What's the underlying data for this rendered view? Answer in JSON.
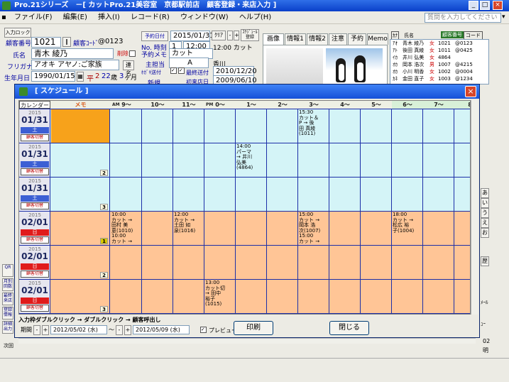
{
  "window": {
    "title": "Pro.21シリーズ　－[ カットPro.21美容室　京都駅前店　顧客登録・来店入力 ]",
    "min": "_",
    "max": "□",
    "close": "×"
  },
  "menu": [
    "ファイル(F)",
    "編集(E)",
    "挿入(I)",
    "レコード(R)",
    "ウィンドウ(W)",
    "ヘルプ(H)"
  ],
  "help_placeholder": "質問を入力してください",
  "form": {
    "input_lock": "入力ロック",
    "customer_no_label": "顧客番号",
    "customer_no": "1021",
    "customer_code_label": "顧客ｺｰﾄﾞ",
    "customer_code": "@0123",
    "name_label": "氏名",
    "name": "青木 綾乃",
    "delete_label": "削除",
    "kana_label": "フリガナ",
    "kana": "アオキ アヤノ:ご家族",
    "link_btn": "連名",
    "birth_label": "生年月日",
    "birth": "1990/01/15",
    "era": "平",
    "era_year": "2",
    "age": "22",
    "age_unit": "歳",
    "months": "3",
    "month_unit": "ヶ月",
    "visit_label": "予約日付",
    "visit_date": "2015/01/31",
    "clear_btn": "ｸﾘｱ",
    "schedule_btn": "ｽｹｼﾞｭｰﾙ 登録",
    "time_label": "No. 時刻",
    "time_no": "1",
    "time_val": "12:00",
    "time_text": "12:00 カット",
    "memo_label": "予約メモ",
    "memo_val": "カット",
    "staff_label": "主担当",
    "staff_rank": "A",
    "staff_name": "香川",
    "dm_label": "ﾎｶﾞｷ送付",
    "last_send_label": "最終送付",
    "last_send": "2010/12/20",
    "new_label": "新規",
    "first_visit_label": "初来店日",
    "first_visit": "2009/06/10"
  },
  "tabs": [
    "画像",
    "情報1",
    "情報2",
    "注意",
    "予約",
    "Memo"
  ],
  "right_panel": {
    "header": [
      "ｶﾅ",
      "氏名",
      "顧客番号",
      "コード"
    ],
    "rows": [
      [
        "ｱｵ",
        "青木 綾乃",
        "女",
        "1021",
        "@0123"
      ],
      [
        "ｱﾄ",
        "後田 真綾",
        "女",
        "1011",
        "@0425"
      ],
      [
        "ｲｶ",
        "井川 弘美",
        "女",
        "4864",
        ""
      ],
      [
        "ｵｶ",
        "岡本 浩次",
        "男",
        "1007",
        "@4215"
      ],
      [
        "ｵｶ",
        "小川 明香",
        "女",
        "1002",
        "@0004"
      ],
      [
        "ｶﾈ",
        "金田 直子",
        "女",
        "1003",
        "@1234"
      ]
    ]
  },
  "schedule": {
    "title": "[ スケジュール ]",
    "calendar_btn": "カレンダー",
    "memo_header": "メモ",
    "am": "AM",
    "pm": "PM",
    "hours": [
      "9～",
      "10～",
      "11～",
      "0～",
      "1～",
      "2～",
      "3～",
      "4～",
      "5～",
      "6～",
      "7～",
      "8"
    ],
    "rows": [
      {
        "year": "2015",
        "date": "01/31",
        "wday": "土",
        "wday_color": "#3c5fd4",
        "btn": "顧客切替",
        "count": "",
        "memo_color": "#f7a21b",
        "bg": "#d4f4f7"
      },
      {
        "year": "2015",
        "date": "01/31",
        "wday": "土",
        "wday_color": "#3c5fd4",
        "btn": "顧客切替",
        "count": "2",
        "memo_color": "#d4f4f7",
        "bg": "#d4f4f7"
      },
      {
        "year": "2015",
        "date": "01/31",
        "wday": "土",
        "wday_color": "#3c5fd4",
        "btn": "顧客切替",
        "count": "3",
        "memo_color": "#d4f4f7",
        "bg": "#d4f4f7"
      },
      {
        "year": "2015",
        "date": "02/01",
        "wday": "日",
        "wday_color": "#e01b1b",
        "btn": "顧客切替",
        "count": "1",
        "memo_color": "#ffc596",
        "bg": "#ffc596"
      },
      {
        "year": "2015",
        "date": "02/01",
        "wday": "日",
        "wday_color": "#e01b1b",
        "btn": "顧客切替",
        "count": "2",
        "memo_color": "#ffc596",
        "bg": "#ffc596"
      },
      {
        "year": "2015",
        "date": "02/01",
        "wday": "日",
        "wday_color": "#e01b1b",
        "btn": "顧客切替",
        "count": "3",
        "memo_color": "#ffc596",
        "bg": "#ffc596"
      }
    ],
    "appointments": [
      {
        "row": 0,
        "col": 6,
        "lines": [
          "15:30",
          "カット＆",
          "P → 後",
          "田 真綾",
          "(1011)"
        ]
      },
      {
        "row": 1,
        "col": 4,
        "lines": [
          "14:00",
          "パーマ",
          "→ 井川",
          "弘美",
          "(4864)"
        ]
      },
      {
        "row": 3,
        "col": 0,
        "lines": [
          "10:00",
          "カット →",
          "田村 美",
          "恵(1010)",
          "10:00",
          "カット →"
        ]
      },
      {
        "row": 3,
        "col": 2,
        "lines": [
          "12:00",
          "カット →",
          "土田 如",
          "泉(1016)"
        ]
      },
      {
        "row": 3,
        "col": 6,
        "lines": [
          "15:00",
          "カット →",
          "岡本 浩",
          "次(1007)",
          "15:00",
          "カット →"
        ]
      },
      {
        "row": 3,
        "col": 9,
        "lines": [
          "18:00",
          "カット →",
          "松広 裕",
          "子(1004)"
        ]
      },
      {
        "row": 5,
        "col": 3,
        "lines": [
          "13:00",
          "カット切",
          "→ 田中",
          "裕子",
          "(1015)"
        ]
      }
    ],
    "footer_hint": "入力枠ダブルクリック → ダブルクリック → 顧客呼出し",
    "period_label": "期間",
    "period_from": "2012/05/02 (水)",
    "period_to": "2012/05/09 (水)",
    "preview_label": "プレビュー",
    "print_btn": "印刷",
    "close_btn": "閉じる"
  },
  "side_buttons": [
    "QR",
    "月別 回数",
    "最終 来店",
    "登録 情報",
    "詳細 出力",
    "次回"
  ],
  "right_side": [
    "あ",
    "い",
    "う",
    "え",
    "お",
    "歴",
    "ﾒｰﾙ",
    "ｭｰ",
    "02",
    "明"
  ]
}
